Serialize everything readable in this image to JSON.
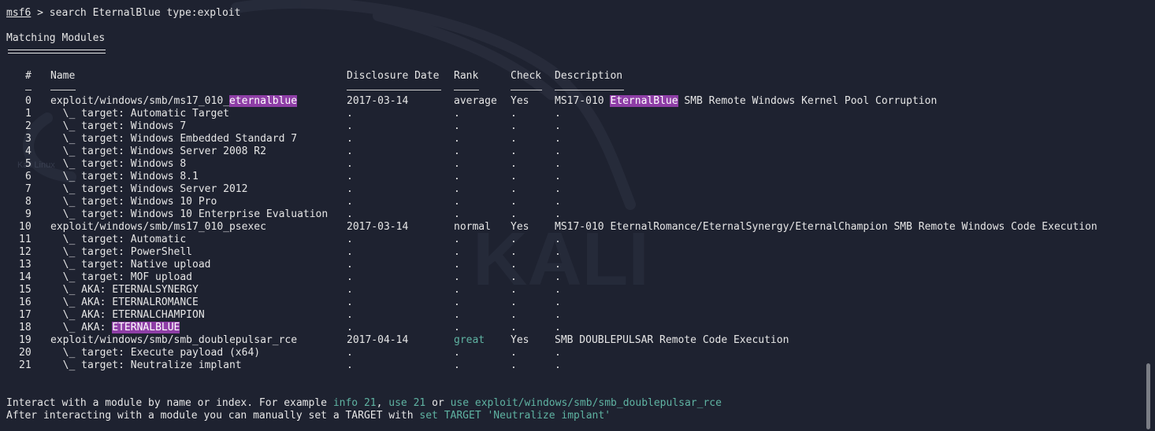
{
  "prompt": {
    "app": "msf6",
    "sep": " > ",
    "command": "search EternalBlue type:exploit"
  },
  "heading": "Matching Modules",
  "headers": {
    "num": "#",
    "name": "Name",
    "date": "Disclosure Date",
    "rank": "Rank",
    "check": "Check",
    "desc": "Description"
  },
  "rows": [
    {
      "num": "0",
      "name_pre": "exploit/windows/smb/ms17_010_",
      "name_hl": "eternalblue",
      "date": "2017-03-14",
      "rank": "average",
      "check": "Yes",
      "desc_pre": "MS17-010 ",
      "desc_hl": "EternalBlue",
      "desc_post": " SMB Remote Windows Kernel Pool Corruption"
    },
    {
      "num": "1",
      "name_pre": "  \\_ target: Automatic Target",
      "date": ".",
      "rank": ".",
      "check": ".",
      "desc_pre": "."
    },
    {
      "num": "2",
      "name_pre": "  \\_ target: Windows 7",
      "date": ".",
      "rank": ".",
      "check": ".",
      "desc_pre": "."
    },
    {
      "num": "3",
      "name_pre": "  \\_ target: Windows Embedded Standard 7",
      "date": ".",
      "rank": ".",
      "check": ".",
      "desc_pre": "."
    },
    {
      "num": "4",
      "name_pre": "  \\_ target: Windows Server 2008 R2",
      "date": ".",
      "rank": ".",
      "check": ".",
      "desc_pre": "."
    },
    {
      "num": "5",
      "name_pre": "  \\_ target: Windows 8",
      "date": ".",
      "rank": ".",
      "check": ".",
      "desc_pre": "."
    },
    {
      "num": "6",
      "name_pre": "  \\_ target: Windows 8.1",
      "date": ".",
      "rank": ".",
      "check": ".",
      "desc_pre": "."
    },
    {
      "num": "7",
      "name_pre": "  \\_ target: Windows Server 2012",
      "date": ".",
      "rank": ".",
      "check": ".",
      "desc_pre": "."
    },
    {
      "num": "8",
      "name_pre": "  \\_ target: Windows 10 Pro",
      "date": ".",
      "rank": ".",
      "check": ".",
      "desc_pre": "."
    },
    {
      "num": "9",
      "name_pre": "  \\_ target: Windows 10 Enterprise Evaluation",
      "date": ".",
      "rank": ".",
      "check": ".",
      "desc_pre": "."
    },
    {
      "num": "10",
      "name_pre": "exploit/windows/smb/ms17_010_psexec",
      "date": "2017-03-14",
      "rank": "normal",
      "check": "Yes",
      "desc_pre": "MS17-010 EternalRomance/EternalSynergy/EternalChampion SMB Remote Windows Code Execution"
    },
    {
      "num": "11",
      "name_pre": "  \\_ target: Automatic",
      "date": ".",
      "rank": ".",
      "check": ".",
      "desc_pre": "."
    },
    {
      "num": "12",
      "name_pre": "  \\_ target: PowerShell",
      "date": ".",
      "rank": ".",
      "check": ".",
      "desc_pre": "."
    },
    {
      "num": "13",
      "name_pre": "  \\_ target: Native upload",
      "date": ".",
      "rank": ".",
      "check": ".",
      "desc_pre": "."
    },
    {
      "num": "14",
      "name_pre": "  \\_ target: MOF upload",
      "date": ".",
      "rank": ".",
      "check": ".",
      "desc_pre": "."
    },
    {
      "num": "15",
      "name_pre": "  \\_ AKA: ETERNALSYNERGY",
      "date": ".",
      "rank": ".",
      "check": ".",
      "desc_pre": "."
    },
    {
      "num": "16",
      "name_pre": "  \\_ AKA: ETERNALROMANCE",
      "date": ".",
      "rank": ".",
      "check": ".",
      "desc_pre": "."
    },
    {
      "num": "17",
      "name_pre": "  \\_ AKA: ETERNALCHAMPION",
      "date": ".",
      "rank": ".",
      "check": ".",
      "desc_pre": "."
    },
    {
      "num": "18",
      "name_pre": "  \\_ AKA: ",
      "name_hl": "ETERNALBLUE",
      "date": ".",
      "rank": ".",
      "check": ".",
      "desc_pre": "."
    },
    {
      "num": "19",
      "name_pre": "exploit/windows/smb/smb_doublepulsar_rce",
      "date": "2017-04-14",
      "rank": "great",
      "rank_green": true,
      "check": "Yes",
      "desc_pre": "SMB DOUBLEPULSAR Remote Code Execution"
    },
    {
      "num": "20",
      "name_pre": "  \\_ target: Execute payload (x64)",
      "date": ".",
      "rank": ".",
      "check": ".",
      "desc_pre": "."
    },
    {
      "num": "21",
      "name_pre": "  \\_ target: Neutralize implant",
      "date": ".",
      "rank": ".",
      "check": ".",
      "desc_pre": "."
    }
  ],
  "footer": [
    [
      {
        "t": "Interact with a module by name or index. For example "
      },
      {
        "t": "info 21",
        "g": true
      },
      {
        "t": ", "
      },
      {
        "t": "use 21",
        "g": true
      },
      {
        "t": " or "
      },
      {
        "t": "use exploit/windows/smb/smb_doublepulsar_rce",
        "g": true
      }
    ],
    [
      {
        "t": "After interacting with a module you can manually set a TARGET with "
      },
      {
        "t": "set TARGET 'Neutralize implant'",
        "g": true
      }
    ]
  ],
  "watermark": {
    "word": "KALI",
    "small": "Kali Linux"
  },
  "colors": {
    "background": "#1e2230",
    "text": "#e6e6e6",
    "highlight": "#8e3ea6",
    "green": "#5fb3a2"
  }
}
